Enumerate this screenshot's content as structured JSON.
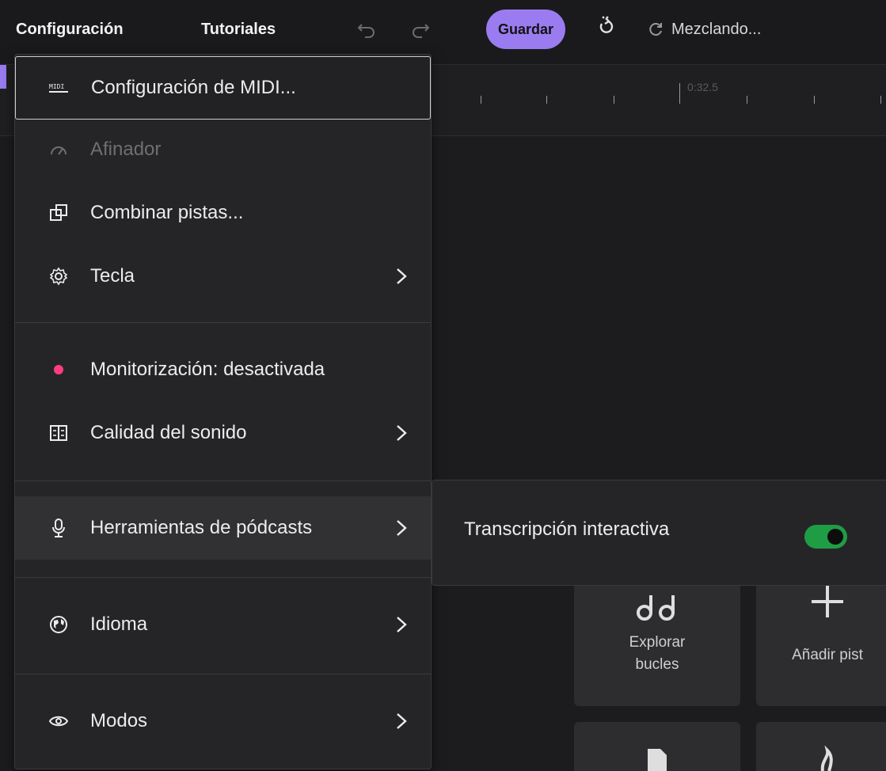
{
  "topbar": {
    "config_label": "Configuración",
    "tutorials_label": "Tutoriales",
    "save_label": "Guardar",
    "mixing_label": "Mezclando..."
  },
  "ruler": {
    "time_label": "0:32.5"
  },
  "menu": {
    "items": [
      {
        "label": "Configuración de MIDI...",
        "icon": "midi-icon",
        "state": "focused"
      },
      {
        "label": "Afinador",
        "icon": "tuner-icon",
        "state": "disabled"
      },
      {
        "label": "Combinar pistas...",
        "icon": "combine-icon"
      },
      {
        "label": "Tecla",
        "icon": "settings-icon",
        "submenu": true
      },
      {
        "label": "Monitorización: desactivada",
        "icon": "dot-icon",
        "icon_color": "#ff3d7f"
      },
      {
        "label": "Calidad del sonido",
        "icon": "quality-icon",
        "submenu": true
      },
      {
        "label": "Herramientas de pódcasts",
        "icon": "microphone-icon",
        "submenu": true,
        "state": "hover"
      },
      {
        "label": "Idioma",
        "icon": "globe-icon",
        "submenu": true
      },
      {
        "label": "Modos",
        "icon": "eye-icon",
        "submenu": true
      }
    ]
  },
  "submenu": {
    "label": "Transcripción interactiva",
    "toggle_on": true,
    "toggle_color": "#1f9d45"
  },
  "tiles": {
    "explore_label_line1": "Explorar",
    "explore_label_line2": "bucles",
    "add_track_label": "Añadir pist"
  },
  "colors": {
    "accent": "#9a7cf0",
    "background": "#1e1e20",
    "menu_bg": "#252528"
  }
}
